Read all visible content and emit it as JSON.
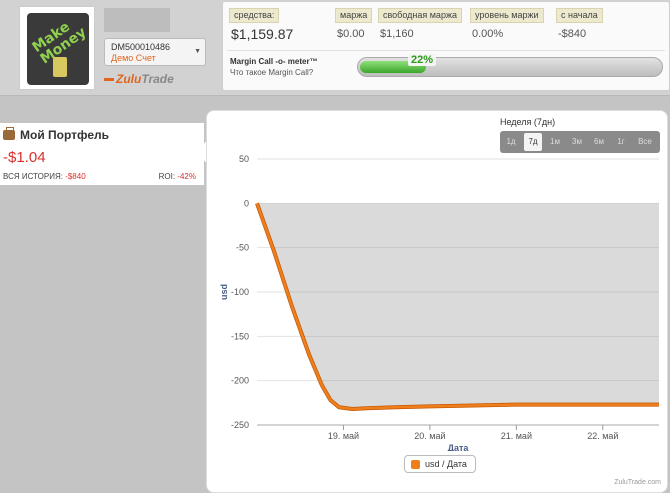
{
  "header": {
    "logo_text": "Make Money",
    "account": {
      "id": "DM500010486",
      "type": "Демо Счет"
    },
    "brand": {
      "part1": "Zulu",
      "part2": "Trade"
    }
  },
  "stats": [
    {
      "label": "средства:",
      "value": "$1,159.87"
    },
    {
      "label": "маржа",
      "value": "$0.00"
    },
    {
      "label": "свободная маржа",
      "value": "$1,160"
    },
    {
      "label": "уровень маржи",
      "value": "0.00%"
    },
    {
      "label": "с начала",
      "value": "-$840"
    }
  ],
  "margin_call": {
    "title": "Margin Call -o- meter™",
    "subtitle": "Что такое Margin Call?",
    "percent_label": "22%",
    "percent": 22
  },
  "portfolio": {
    "title": "Мой Портфель",
    "value": "-$1.04",
    "history_label": "ВСЯ ИСТОРИЯ:",
    "history_value": "-$840",
    "roi_label": "ROI:",
    "roi_value": "-42%"
  },
  "range_selector": {
    "title": "Неделя (7дн)",
    "buttons": [
      "1д",
      "7д",
      "1м",
      "3м",
      "6м",
      "1г",
      "Все"
    ],
    "active": "7д"
  },
  "chart_data": {
    "type": "line",
    "ylabel": "usd",
    "xlabel": "Дата",
    "ylim": [
      -250,
      50
    ],
    "yticks": [
      50,
      0,
      -50,
      -100,
      -150,
      -200,
      -250
    ],
    "xticks": [
      "19. май",
      "20. май",
      "21. май",
      "22. май"
    ],
    "xtick_values": [
      1,
      2,
      3,
      4
    ],
    "xlim": [
      0,
      4.65
    ],
    "grid": true,
    "legend_position": "bottom-center",
    "series": [
      {
        "name": "usd / Дата",
        "color": "#f07e1b",
        "x": [
          0,
          0.2,
          0.4,
          0.6,
          0.75,
          0.85,
          0.95,
          1.1,
          1.3,
          1.6,
          2.0,
          2.5,
          3.0,
          3.5,
          4.0,
          4.4,
          4.65
        ],
        "y": [
          0,
          -55,
          -115,
          -170,
          -205,
          -222,
          -230,
          -232,
          -231,
          -230,
          -229,
          -228,
          -227,
          -227,
          -227,
          -227,
          -227
        ]
      }
    ],
    "credit": "ZuluTrade.com"
  }
}
